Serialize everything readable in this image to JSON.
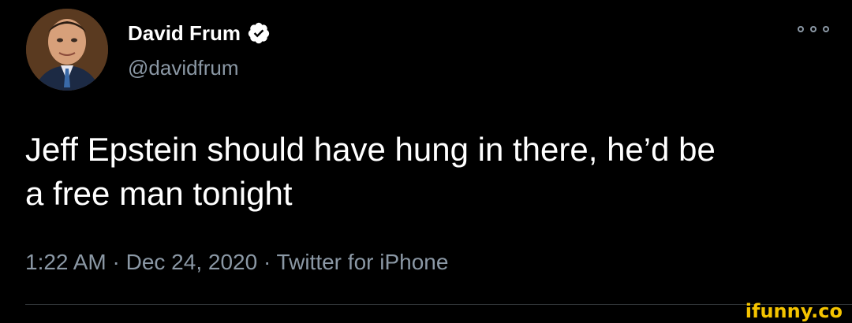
{
  "tweet": {
    "author": {
      "display_name": "David Frum",
      "handle": "@davidfrum",
      "verified": true,
      "avatar_icon": "avatar-photo"
    },
    "more_icon": "more-options-icon",
    "text_line1": "Jeff Epstein should have hung in there, he’d be",
    "text_line2": "a free man tonight",
    "timestamp": "1:22 AM · Dec 24, 2020 · Twitter for iPhone"
  },
  "watermark": {
    "text": "ifunny.co",
    "color": "#f5c400"
  },
  "colors": {
    "background": "#000000",
    "primary_text": "#ffffff",
    "secondary_text": "#8b98a5",
    "verified": "#ffffff"
  }
}
